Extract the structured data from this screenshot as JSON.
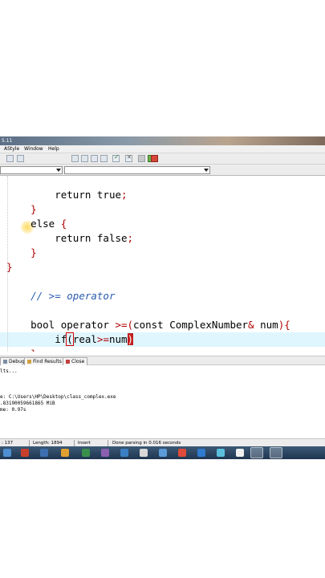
{
  "window": {
    "title_fragment": "5.11"
  },
  "menu": {
    "items": [
      "AStyle",
      "Window",
      "Help"
    ]
  },
  "editor": {
    "lines": [
      {
        "indent": "        ",
        "parts": [
          [
            "return true",
            "kw"
          ],
          [
            ";",
            "red"
          ]
        ]
      },
      {
        "indent": "    ",
        "parts": [
          [
            "}",
            "red"
          ]
        ]
      },
      {
        "indent": "    ",
        "parts": [
          [
            "else ",
            "kw"
          ],
          [
            "{",
            "red"
          ]
        ]
      },
      {
        "indent": "        ",
        "parts": [
          [
            "return false",
            "kw"
          ],
          [
            ";",
            "red"
          ]
        ]
      },
      {
        "indent": "    ",
        "parts": [
          [
            "}",
            "red"
          ]
        ]
      },
      {
        "indent": "",
        "parts": [
          [
            "}",
            "red"
          ]
        ]
      },
      {
        "indent": "",
        "parts": []
      },
      {
        "indent": "    ",
        "parts": [
          [
            "// >= operator",
            "cm"
          ]
        ]
      },
      {
        "indent": "",
        "parts": []
      },
      {
        "indent": "    ",
        "parts": [
          [
            "bool operator ",
            "kw"
          ],
          [
            ">=(",
            "red"
          ],
          [
            "const ComplexNumber",
            "kw"
          ],
          [
            "&",
            "red"
          ],
          [
            " num",
            "kw"
          ],
          [
            ")",
            "red"
          ],
          [
            "{",
            "red"
          ]
        ]
      },
      {
        "indent": "        ",
        "parts": [
          [
            "if",
            "kw"
          ],
          [
            "(",
            "caret-box"
          ],
          [
            "real",
            "kw"
          ],
          [
            ">=",
            "red"
          ],
          [
            "num",
            "kw"
          ],
          [
            ")",
            "caret-fill"
          ]
        ]
      },
      {
        "indent": "    ",
        "parts": [
          [
            "}",
            "red"
          ]
        ]
      }
    ]
  },
  "logs": {
    "tabs": [
      "Debug",
      "Find Results",
      "Close"
    ],
    "lines": [
      "lts...",
      "",
      "",
      "e: C:\\Users\\HP\\Desktop\\class_complex.exe",
      ".83190059661865 MiB",
      "me: 0.97s"
    ]
  },
  "status": {
    "line": ": 137",
    "length": "Length: 1894",
    "mode": "Insert",
    "message": "Done parsing in 0.016 seconds"
  },
  "colors": {
    "keyword": "#000000",
    "punctuation": "#b00000",
    "comment": "#2a5db0",
    "current_line": "#dff6ff",
    "taskbar": "#1f3550"
  }
}
